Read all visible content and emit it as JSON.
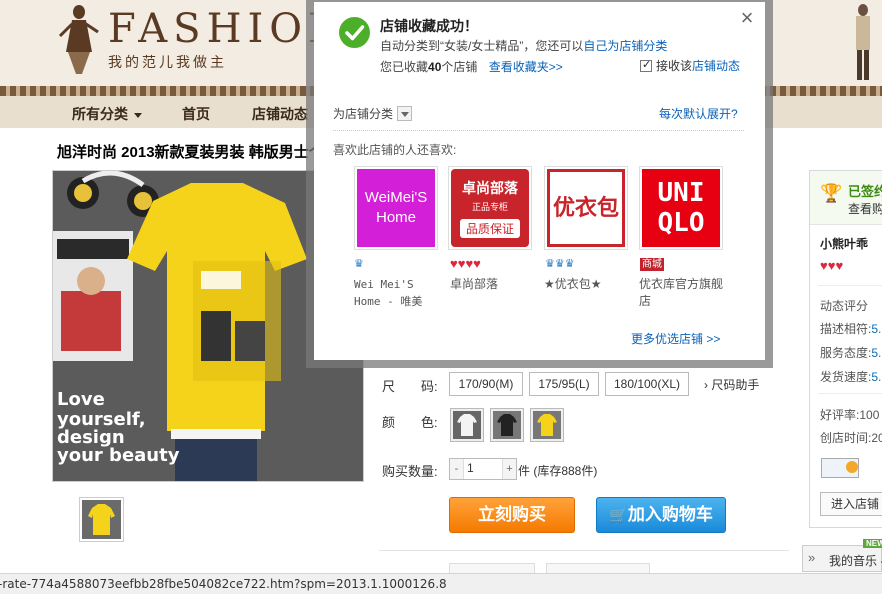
{
  "header": {
    "brand": "FASHION SHO",
    "slogan": "我的范儿我做主"
  },
  "nav": {
    "items": [
      {
        "label": "所有分类"
      },
      {
        "label": "首页"
      },
      {
        "label": "店铺动态"
      }
    ]
  },
  "product": {
    "title": "旭洋时尚 2013新款夏装男装 韩版男士个",
    "size_label": "尺　　码:",
    "sizes": [
      "170/90(M)",
      "175/95(L)",
      "180/100(XL)"
    ],
    "size_help": "尺码助手",
    "color_label": "颜　　色:",
    "qty_label": "购买数量:",
    "qty_minus": "-",
    "qty_value": "1",
    "qty_plus": "+",
    "stock": "件 (库存888件)",
    "buy_now": "立刻购买",
    "add_to_cart": "加入购物车"
  },
  "shop_panel": {
    "signed": "已签约",
    "view": "查看购",
    "shop_name": "小熊叶乖",
    "rating_title": "动态评分",
    "desc_label": "描述相符:",
    "desc_value": "5.",
    "service_label": "服务态度:",
    "service_value": "5.",
    "shipping_label": "发货速度:",
    "shipping_value": "5.",
    "positive_label": "好评率:",
    "positive_value": "100",
    "created_label": "创店时间:",
    "created_value": "20",
    "enter_shop": "进入店铺"
  },
  "music_bar": {
    "label": "我的音乐 -",
    "new_badge": "NEW",
    "collapse": "»"
  },
  "status_bar": {
    "url": "-rate-774a4588073eefbb28fbe504082ce722.htm?spm=2013.1.1000126.8"
  },
  "modal": {
    "title": "店铺收藏成功！",
    "subtitle_prefix": "自动分类到“女装/女士精品”，您还可以",
    "subtitle_link": "自己为店铺分类",
    "count_prefix": "您已收藏",
    "count_value": "40",
    "count_suffix": "个店铺",
    "view_favorites": "查看收藏夹>>",
    "receive_news_prefix": "接收该",
    "receive_news_link": "店铺动态",
    "category_label": "为店铺分类",
    "default_open": "每次默认展开?",
    "also_like": "喜欢此店铺的人还喜欢:",
    "more_shops": "更多优选店铺 >>",
    "close": "×",
    "recommendations": [
      {
        "logo_text": "WeiMei'S Home",
        "name": "Wei Mei'S Home - 唯美",
        "badge_type": "crown",
        "badge_count": 1,
        "logo_bg": "#d31fd8",
        "logo_fg": "#ffffff"
      },
      {
        "logo_text": "卓尚部落",
        "logo_sub": "正品专柜",
        "logo_bottom": "品质保证",
        "name": "卓尚部落",
        "badge_type": "heart",
        "badge_count": 4,
        "logo_bg": "#c8242b",
        "logo_fg": "#ffffff"
      },
      {
        "logo_text": "优衣包",
        "name": "★优衣包★",
        "badge_type": "crown",
        "badge_count": 3,
        "logo_bg": "#ffffff",
        "logo_fg": "#c8242b"
      },
      {
        "logo_text": "UNI QLO",
        "name": "优衣库官方旗舰店",
        "badge_type": "mall",
        "badge_label": "商城",
        "logo_bg": "#e60012",
        "logo_fg": "#ffffff"
      }
    ]
  },
  "colors": {
    "accent_orange": "#f57a00",
    "accent_blue": "#1a8ad8",
    "link_blue": "#0a62b8",
    "success_green": "#4caf2a"
  }
}
